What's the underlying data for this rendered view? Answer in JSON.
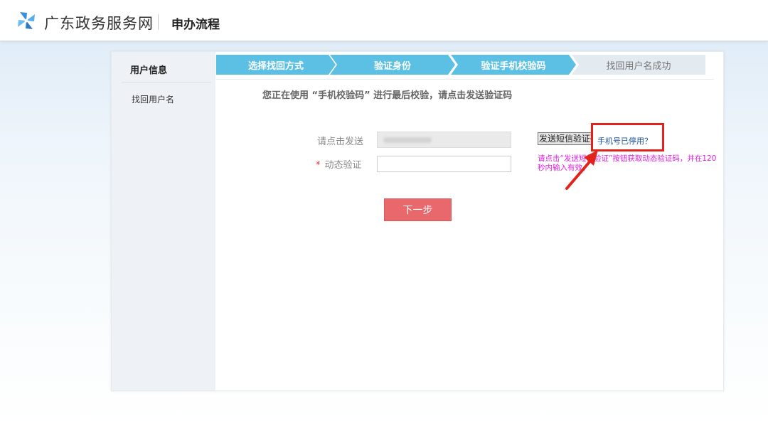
{
  "header": {
    "site_title": "广东政务服务网",
    "page_heading": "申办流程"
  },
  "sidebar": {
    "title": "用户信息",
    "items": [
      {
        "label": "找回用户名"
      }
    ]
  },
  "steps": [
    {
      "label": "选择找回方式",
      "state": "done"
    },
    {
      "label": "验证身份",
      "state": "done"
    },
    {
      "label": "验证手机校验码",
      "state": "current"
    },
    {
      "label": "找回用户名成功",
      "state": "pending"
    }
  ],
  "form": {
    "instruction": "您正在使用 “手机校验码” 进行最后校验，请点击发送验证码",
    "send_label": "请点击发送",
    "phone_value": "",
    "code_required_mark": "*",
    "code_label": "动态验证",
    "code_value": "",
    "sms_button_label": "发送短信验证码",
    "phone_stopped_link": "手机号已停用？",
    "hint": "请点击“发送短信验证”按钮获取动态验证码，并在120秒内输入有效。",
    "next_button_label": "下一步"
  },
  "colors": {
    "step_active": "#5bc0e3",
    "step_pending": "#e3eaf0",
    "next_button": "#e8686b",
    "highlight": "#e2231a",
    "hint_text": "#e020e0",
    "link": "#1a4f9b"
  },
  "icons": {
    "logo": "pinwheel-logo-icon",
    "annotation": "red-arrow-icon"
  }
}
